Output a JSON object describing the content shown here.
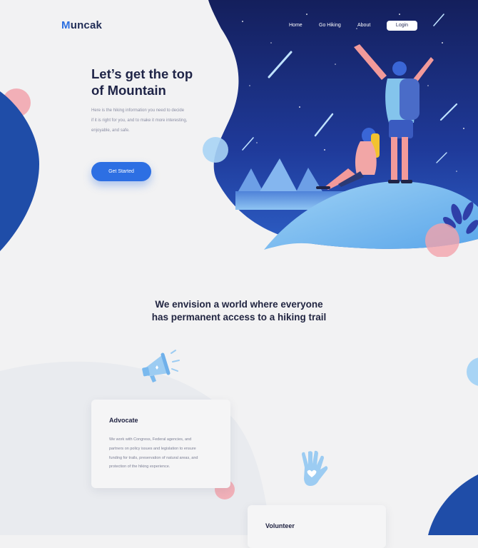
{
  "brand": {
    "first_letter": "M",
    "rest": "uncak"
  },
  "nav": {
    "links": [
      "Home",
      "Go Hiking",
      "About"
    ],
    "login_label": "Login"
  },
  "hero": {
    "title_line1": "Let’s get the top",
    "title_line2": "of Mountain",
    "desc_line1": "Here is the hiking information you need to decide",
    "desc_line2": "if it is right for you, and to make it more interesting,",
    "desc_line3": "enjoyable, and safe.",
    "cta_label": "Get Started"
  },
  "vision": {
    "line1": "We envision a world  where everyone",
    "line2": "has permanent access to a hiking trail"
  },
  "cards": [
    {
      "title": "Advocate",
      "body_lines": [
        "We work with Congress, Federal agencies, and",
        "partners on policy issues and legislation to ensure",
        "funding for trails, preservation of natural areas, and",
        "protection of the hiking experience."
      ]
    },
    {
      "title": "Volunteer"
    }
  ],
  "colors": {
    "background": "#f2f2f3",
    "brand_blue": "#2b6fe0",
    "navy": "#1f2447",
    "night_sky": "#1d2d86",
    "pink_accent": "#f2a3ab",
    "light_blue_accent": "#a8d4f5"
  },
  "icons": {
    "megaphone": "megaphone-icon",
    "hand_heart": "hand-heart-icon"
  }
}
